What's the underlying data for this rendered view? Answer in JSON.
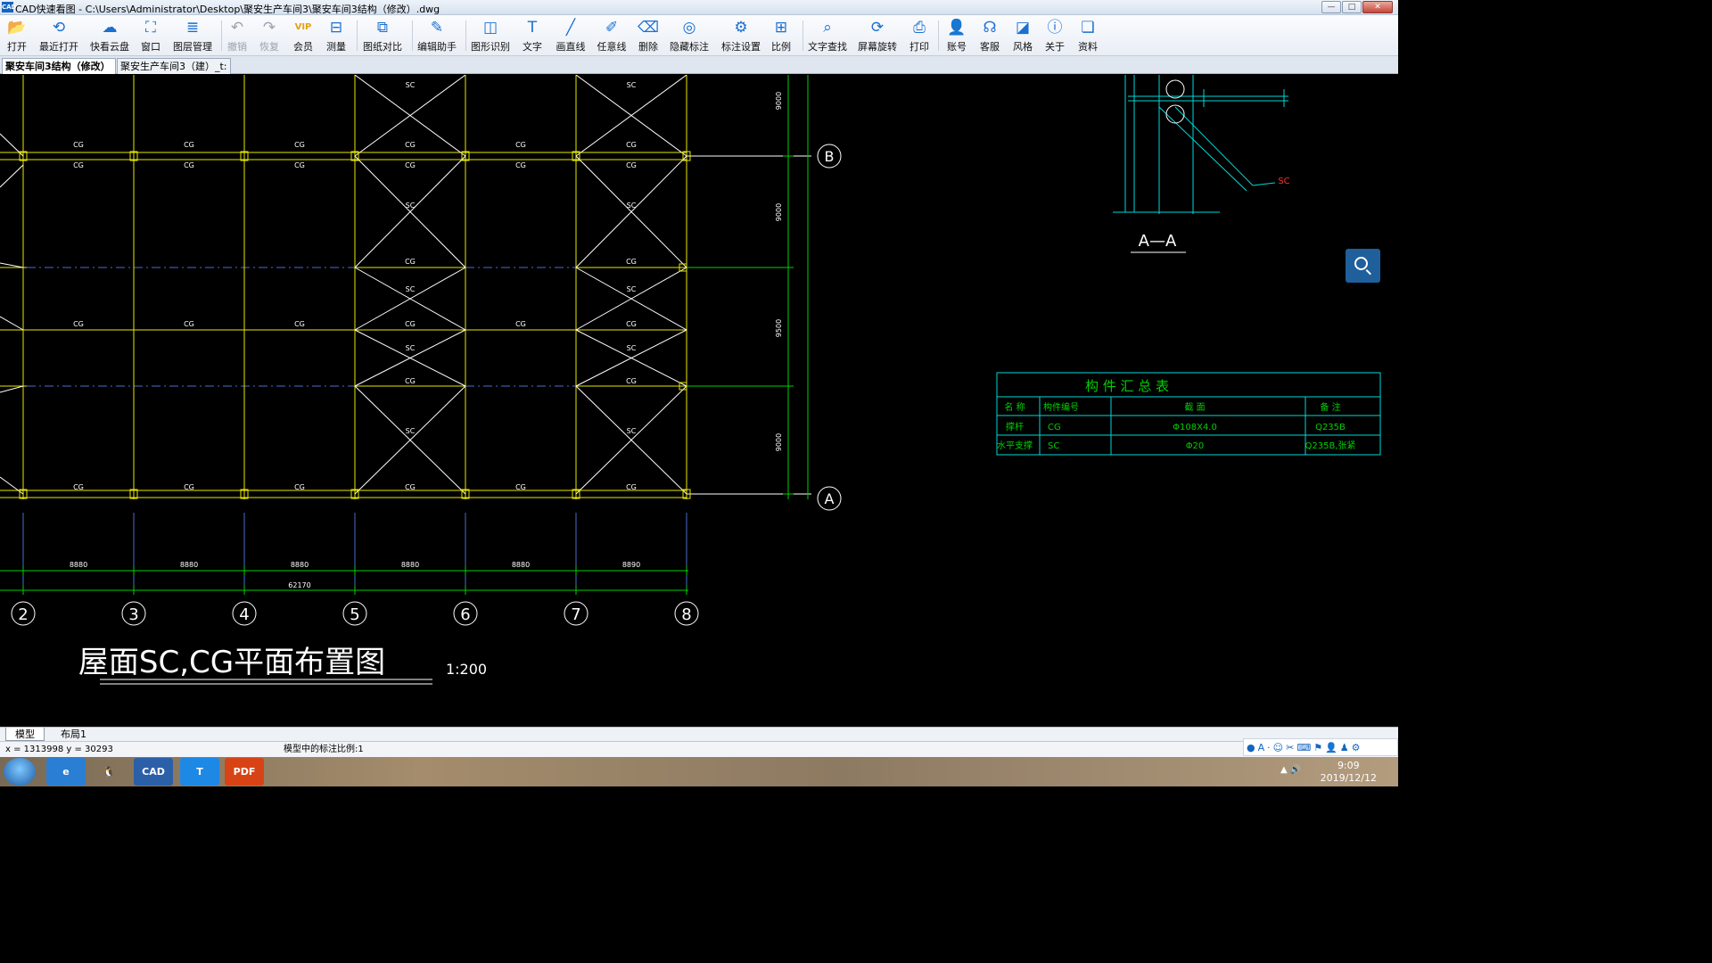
{
  "window": {
    "app_icon_text": "CAD",
    "title": "CAD快速看图 - C:\\Users\\Administrator\\Desktop\\聚安生产车间3\\聚安车间3结构（修改）.dwg",
    "controls": {
      "minimize": "—",
      "maximize": "□",
      "close": "✕"
    }
  },
  "toolbar": {
    "items": [
      {
        "label": "打开",
        "icon": "folder-icon",
        "glyph": "📂"
      },
      {
        "label": "最近打开",
        "icon": "history-icon",
        "glyph": "⟲"
      },
      {
        "label": "快看云盘",
        "icon": "cloud-icon",
        "glyph": "☁"
      },
      {
        "label": "窗口",
        "icon": "window-icon",
        "glyph": "⛶"
      },
      {
        "label": "图层管理",
        "icon": "layers-icon",
        "glyph": "≣"
      },
      {
        "label": "撤销",
        "icon": "undo-icon",
        "glyph": "↶"
      },
      {
        "label": "恢复",
        "icon": "redo-icon",
        "glyph": "↷"
      },
      {
        "label": "会员",
        "icon": "vip-icon",
        "glyph": "VIP"
      },
      {
        "label": "测量",
        "icon": "measure-icon",
        "glyph": "⊟"
      },
      {
        "label": "图纸对比",
        "icon": "compare-icon",
        "glyph": "⧉"
      },
      {
        "label": "编辑助手",
        "icon": "edit-assistant-icon",
        "glyph": "✎"
      },
      {
        "label": "图形识别",
        "icon": "shape-recognition-icon",
        "glyph": "◫"
      },
      {
        "label": "文字",
        "icon": "text-icon",
        "glyph": "T"
      },
      {
        "label": "画直线",
        "icon": "line-icon",
        "glyph": "╱"
      },
      {
        "label": "任意线",
        "icon": "freehand-icon",
        "glyph": "✐"
      },
      {
        "label": "删除",
        "icon": "eraser-icon",
        "glyph": "⌫"
      },
      {
        "label": "隐藏标注",
        "icon": "hide-annotation-icon",
        "glyph": "◎"
      },
      {
        "label": "标注设置",
        "icon": "annotation-settings-icon",
        "glyph": "⚙"
      },
      {
        "label": "比例",
        "icon": "scale-icon",
        "glyph": "⊞"
      },
      {
        "label": "文字查找",
        "icon": "text-search-icon",
        "glyph": "⌕"
      },
      {
        "label": "屏幕旋转",
        "icon": "rotate-icon",
        "glyph": "⟳"
      },
      {
        "label": "打印",
        "icon": "print-icon",
        "glyph": "⎙"
      },
      {
        "label": "账号",
        "icon": "account-icon",
        "glyph": "👤"
      },
      {
        "label": "客服",
        "icon": "headset-icon",
        "glyph": "☊"
      },
      {
        "label": "风格",
        "icon": "style-icon",
        "glyph": "◪"
      },
      {
        "label": "关于",
        "icon": "info-icon",
        "glyph": "ⓘ"
      },
      {
        "label": "资料",
        "icon": "docs-icon",
        "glyph": "❏"
      }
    ]
  },
  "tabs": [
    {
      "label": "聚安车间3结构（修改）",
      "close": "×",
      "active": true
    },
    {
      "label": "聚安生产车间3（建）_t:",
      "close": "×",
      "active": false
    }
  ],
  "drawing": {
    "member_label_cg": "CG",
    "member_label_sc": "SC",
    "grid_axes": [
      "2",
      "3",
      "4",
      "5",
      "6",
      "7",
      "8"
    ],
    "row_axes": [
      "B",
      "A"
    ],
    "bay_dims": [
      "8880",
      "8880",
      "8880",
      "8880",
      "8880",
      "8890"
    ],
    "total_dim": "62170",
    "vertical_dims": [
      "9000",
      "9000",
      "9500",
      "9000"
    ],
    "plan_title": "屋面SC,CG平面布置图",
    "plan_scale": "1:200",
    "section_title": "A—A",
    "section_callout": "SC",
    "member_table": {
      "title": "构 件 汇 总 表",
      "headers": [
        "名 称",
        "构件编号",
        "截 面",
        "备 注"
      ],
      "rows": [
        [
          "撑杆",
          "CG",
          "Φ108X4.0",
          "Q235B"
        ],
        [
          "水平支撑",
          "SC",
          "Φ20",
          "Q235B,张紧"
        ]
      ]
    },
    "colors": {
      "yellow": "#e8e800",
      "green": "#00d000",
      "cyan": "#00d8d8",
      "white": "#ffffff",
      "red": "#ff3030"
    }
  },
  "layout_tabs": [
    {
      "label": "模型",
      "active": true
    },
    {
      "label": "布局1",
      "active": false
    }
  ],
  "status": {
    "coords": "x = 1313998  y = 30293",
    "scale_text": "模型中的标注比例:1"
  },
  "ime_icons": [
    "●",
    "A",
    "·",
    "☺",
    "✂",
    "⌨",
    "⚑",
    "👤",
    "♟",
    "⚙"
  ],
  "taskbar": {
    "apps": [
      {
        "name": "ie-icon",
        "glyph": "e"
      },
      {
        "name": "qq-icon",
        "glyph": "🐧"
      },
      {
        "name": "cad-icon",
        "glyph": "CAD"
      },
      {
        "name": "text-app-icon",
        "glyph": "T"
      },
      {
        "name": "pdf-icon",
        "glyph": "PDF"
      }
    ],
    "time": "9:09",
    "date": "2019/12/12"
  }
}
